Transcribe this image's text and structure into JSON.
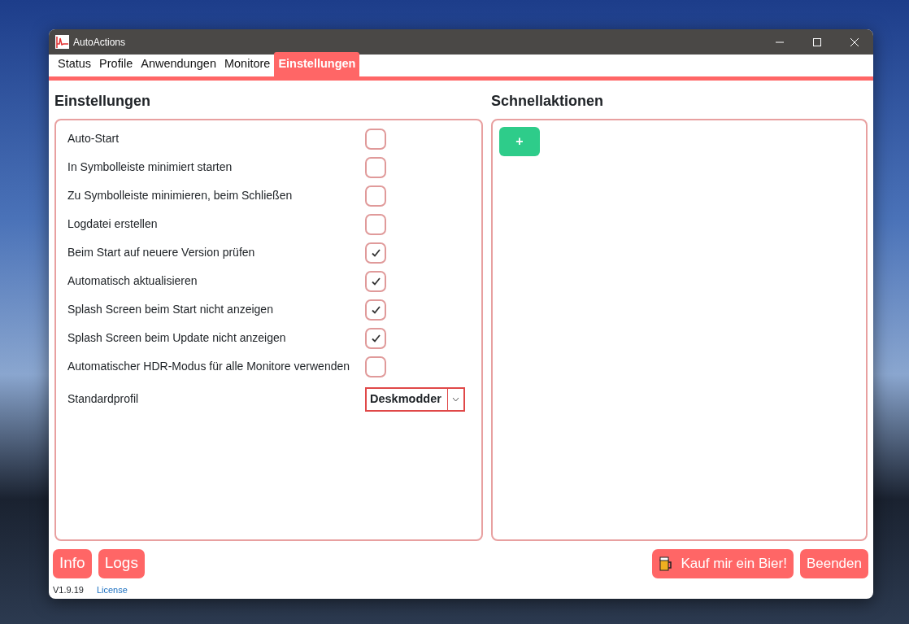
{
  "window": {
    "title": "AutoActions"
  },
  "tabs": [
    {
      "label": "Status",
      "selected": false
    },
    {
      "label": "Profile",
      "selected": false
    },
    {
      "label": "Anwendungen",
      "selected": false
    },
    {
      "label": "Monitore",
      "selected": false
    },
    {
      "label": "Einstellungen",
      "selected": true
    }
  ],
  "settings": {
    "heading": "Einstellungen",
    "items": [
      {
        "kind": "checkbox",
        "label": "Auto-Start",
        "checked": false
      },
      {
        "kind": "checkbox",
        "label": "In Symbolleiste minimiert starten",
        "checked": false
      },
      {
        "kind": "checkbox",
        "label": "Zu Symbolleiste minimieren, beim Schließen",
        "checked": false
      },
      {
        "kind": "checkbox",
        "label": "Logdatei erstellen",
        "checked": false
      },
      {
        "kind": "checkbox",
        "label": "Beim Start auf neuere Version prüfen",
        "checked": true
      },
      {
        "kind": "checkbox",
        "label": "Automatisch aktualisieren",
        "checked": true
      },
      {
        "kind": "checkbox",
        "label": "Splash Screen beim Start nicht anzeigen",
        "checked": true
      },
      {
        "kind": "checkbox",
        "label": "Splash Screen beim Update nicht anzeigen",
        "checked": true
      },
      {
        "kind": "checkbox",
        "label": "Automatischer HDR-Modus für alle Monitore verwenden",
        "checked": false
      },
      {
        "kind": "dropdown",
        "label": "Standardprofil",
        "value": "Deskmodder"
      }
    ]
  },
  "quick_actions": {
    "heading": "Schnellaktionen",
    "add_button": "+"
  },
  "left_buttons": [
    "Info",
    "Logs"
  ],
  "right_buttons": [
    {
      "label": "Kauf mir ein Bier!",
      "kind": "beer"
    },
    {
      "label": "Beenden",
      "kind": "plain"
    }
  ],
  "footer": {
    "version": "V1.9.19",
    "link": "License"
  }
}
